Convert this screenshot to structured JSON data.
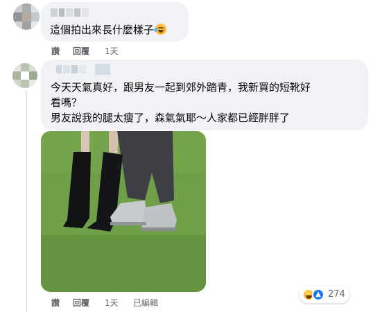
{
  "comments": [
    {
      "text": "這個拍出來長什麼樣子",
      "actions": {
        "like": "讚",
        "reply": "回覆",
        "time": "1天"
      }
    },
    {
      "text_lines": [
        "今天天氣真好，跟男友一起到郊外踏青，我新買的短靴好",
        "看嗎？",
        "男友說我的腿太瘦了，森氣氣耶～人家都已經胖胖了"
      ],
      "actions": {
        "like": "讚",
        "reply": "回覆",
        "time": "1天",
        "edited": "已編輯"
      },
      "reactions": {
        "count": "274",
        "icons": [
          "haha-icon",
          "like-icon"
        ]
      }
    }
  ],
  "colors": {
    "bubble": "#f0f2f5",
    "meta_text": "#65676b",
    "like_blue": "#1877f2",
    "grass": "#6a9a45"
  }
}
